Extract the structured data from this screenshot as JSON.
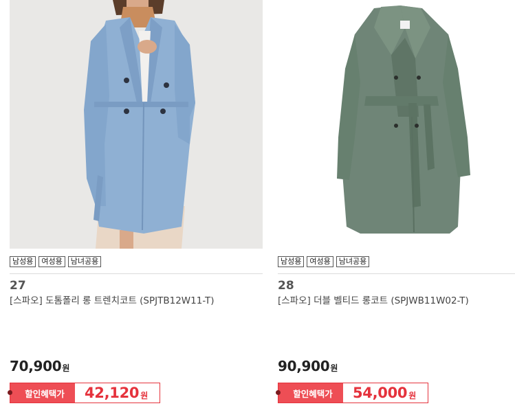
{
  "products": [
    {
      "tags": [
        "남성용",
        "여성용",
        "남녀공용"
      ],
      "rank": "27",
      "name": "[스파오] 도톰폴리 롱 트렌치코트 (SPJTB12W11-T)",
      "price": "70,900",
      "price_unit": "원",
      "discount_label": "할인혜택가",
      "discount_price": "42,120",
      "discount_unit": "원",
      "image": {
        "icon": "blue-trench-coat-photo",
        "coat_color": "#8fb0d3",
        "bg_color": "#e9e8e6"
      }
    },
    {
      "tags": [
        "남성용",
        "여성용",
        "남녀공용"
      ],
      "rank": "28",
      "name": "[스파오] 더블 벨티드 롱코트 (SPJWB11W02-T)",
      "price": "90,900",
      "price_unit": "원",
      "discount_label": "할인혜택가",
      "discount_price": "54,000",
      "discount_unit": "원",
      "image": {
        "icon": "green-belted-coat-photo",
        "coat_color": "#6f8577",
        "bg_color": "#ffffff"
      }
    }
  ],
  "colors": {
    "discount_red": "#e5323c",
    "discount_label_bg": "#ee4e55"
  }
}
